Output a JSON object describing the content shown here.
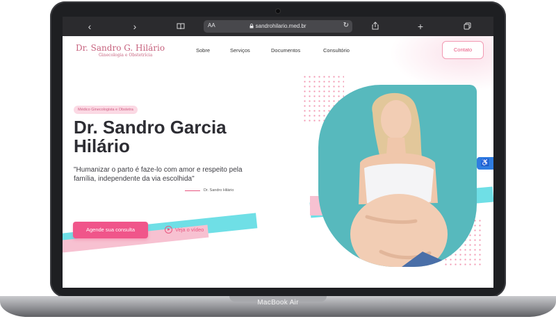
{
  "device": {
    "label": "MacBook Air"
  },
  "browser": {
    "text_size_label": "AA",
    "url": "sandrohilario.med.br",
    "back_icon": "chevron-left-icon",
    "forward_icon": "chevron-right-icon",
    "bookmarks_icon": "book-icon",
    "lock_icon": "lock-icon",
    "reload_icon": "reload-icon",
    "share_icon": "share-icon",
    "new_tab_icon": "plus-icon",
    "tabs_icon": "tabs-icon"
  },
  "site": {
    "brand": {
      "name": "Dr. Sandro G. Hilário",
      "subtitle": "Ginecologia e Obstetrícia"
    },
    "nav": [
      "Sobre",
      "Serviços",
      "Documentos",
      "Consultório"
    ],
    "contact_label": "Contato",
    "badge": "Médico Ginecologista e Obstetra",
    "title_line1": "Dr. Sandro Garcia",
    "title_line2": "Hilário",
    "quote": "\"Humanizar o parto é faze-lo com amor e respeito pela família, independente da via escolhida\"",
    "signature": "Dr. Sandro Hilário",
    "cta_label": "Agende sua consulta",
    "video_label": "Veja o vídeo",
    "accessibility_icon": "accessibility-icon"
  },
  "colors": {
    "accent_pink": "#f0558a",
    "brand_rose": "#c7637f",
    "teal": "#57b9bd",
    "cyan": "#6fdfe6",
    "light_pink": "#f7c1d1",
    "text_dark": "#2d2d33",
    "laptop_body": "#1e1f22",
    "toolbar": "#2b2b2e"
  }
}
